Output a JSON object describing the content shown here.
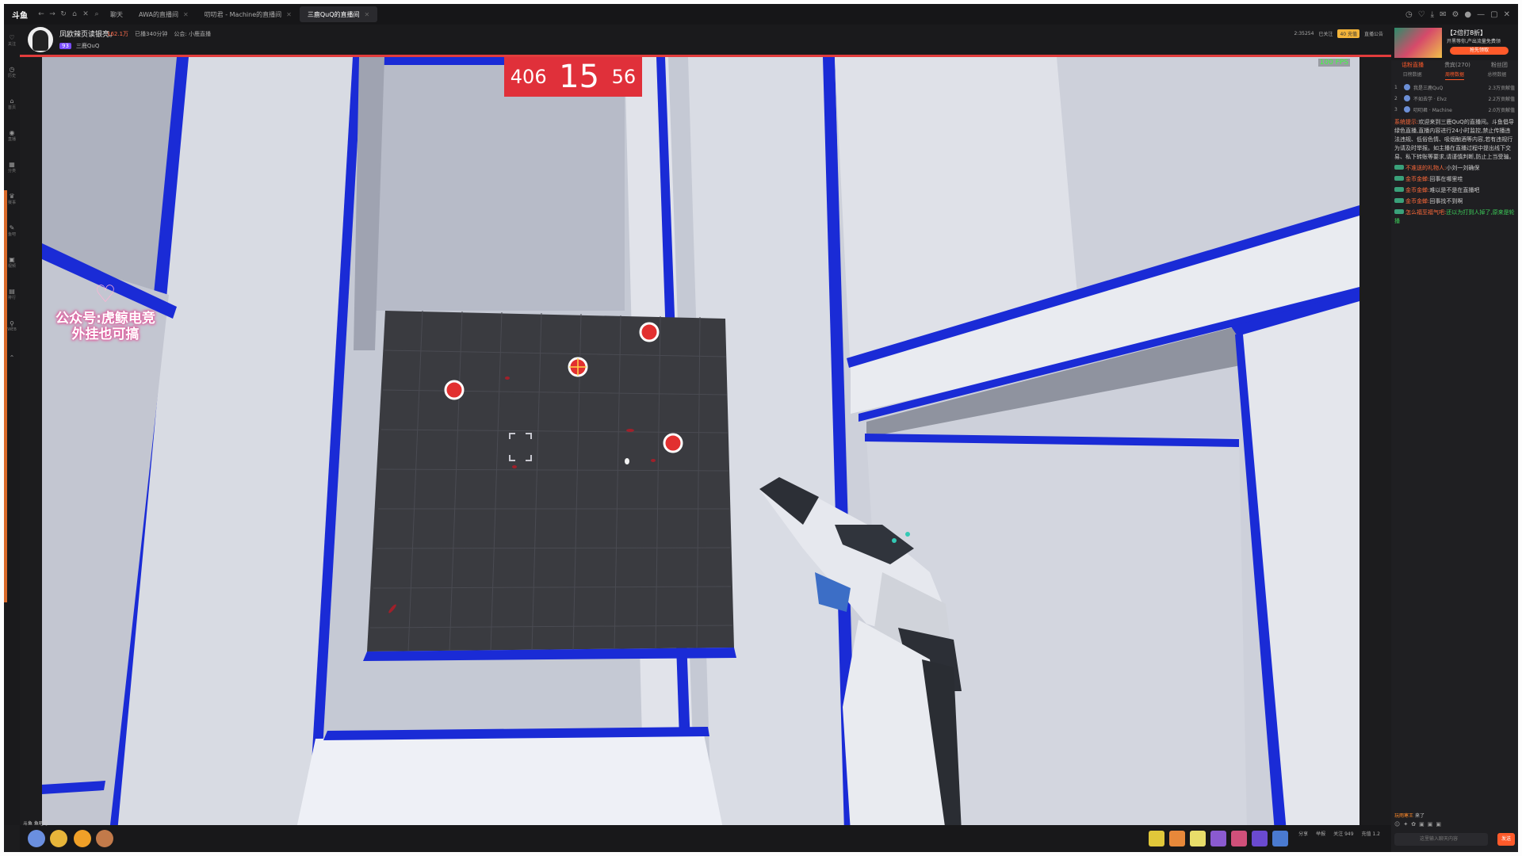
{
  "browser": {
    "logo": "斗鱼",
    "tabs": [
      {
        "label": "聊天",
        "active": false
      },
      {
        "label": "AWA的直播间",
        "active": false
      },
      {
        "label": "叨叨君 - Machine的直播间",
        "active": false
      },
      {
        "label": "三鹿QuQ的直播间",
        "active": true
      }
    ]
  },
  "sidebar": {
    "items": [
      "关注",
      "历史",
      "首页",
      "直播",
      "分类",
      "赛事",
      "鱼吧",
      "视频",
      "排行",
      "WEB"
    ]
  },
  "stream": {
    "title": "凤欧辣页读银亮。",
    "hot": "162.1万",
    "stats": [
      "已播340分钟",
      "公会: 小鹿直播"
    ],
    "streamer": "三鹿QuQ",
    "level": "93",
    "right_info": [
      "2:35254",
      "已关注"
    ],
    "coin": "40 充值",
    "room": "直播公告"
  },
  "game": {
    "score_left": "406",
    "score_mid": "15",
    "score_right": "56",
    "fps": "100 FPS",
    "watermark_line1": "公众号:虎鲸电竞",
    "watermark_line2": "外挂也可搞"
  },
  "chat": {
    "promo_title": "【2倍打8折】",
    "promo_sub": "开黑等你,产出流量免费领",
    "promo_button": "抢先领取",
    "tabs": [
      "话粉直播",
      "贵宾(270)",
      "粉丝团"
    ],
    "subtabs": [
      "日榜数据",
      "周榜数据",
      "总榜数据"
    ],
    "rank": [
      {
        "n": "1",
        "name": "我是三鹿QuQ",
        "amount": "2.3万贡献值"
      },
      {
        "n": "2",
        "name": "不如去学 · Elvz",
        "amount": "2.2万贡献值"
      },
      {
        "n": "3",
        "name": "叨叨君 · Machine",
        "amount": "2.0万贡献值"
      }
    ],
    "system_label": "系统提示:",
    "system_text": "欢迎来到三鹿QuQ的直播间。斗鱼倡导绿色直播,直播内容进行24小时监控,禁止传播违法违规、低俗色情、吸烟酗酒等内容,若有违规行为请及时举报。如主播在直播过程中提出线下交易、私下转账等要求,请谨慎判断,防止上当受骗。",
    "messages": [
      {
        "name": "不准送的礼物人:",
        "text": "小刘一刘确保"
      },
      {
        "name": "金币金蝉:",
        "text": "回事在哪里哇"
      },
      {
        "name": "金币金蝉:",
        "text": "难以是不是在直播吧"
      },
      {
        "name": "金币金蝉:",
        "text": "回事找不到啊"
      },
      {
        "name": "怎么福至福气吧:",
        "text": "还以为打到人掉了,原来是轮播"
      }
    ],
    "enter_name": "玩雨寒王",
    "enter_text": "来了",
    "input_placeholder": "这里输入聊天内容",
    "send_label": "发送"
  },
  "bottom": {
    "tag": "斗鱼 鱼吧号",
    "right": [
      "分享",
      "举报",
      "关注 949",
      "充值 1.2"
    ]
  },
  "colors": {
    "accent": "#ff5a2a",
    "score_bg": "#e0303a",
    "wall_blue": "#1a2bd6"
  }
}
